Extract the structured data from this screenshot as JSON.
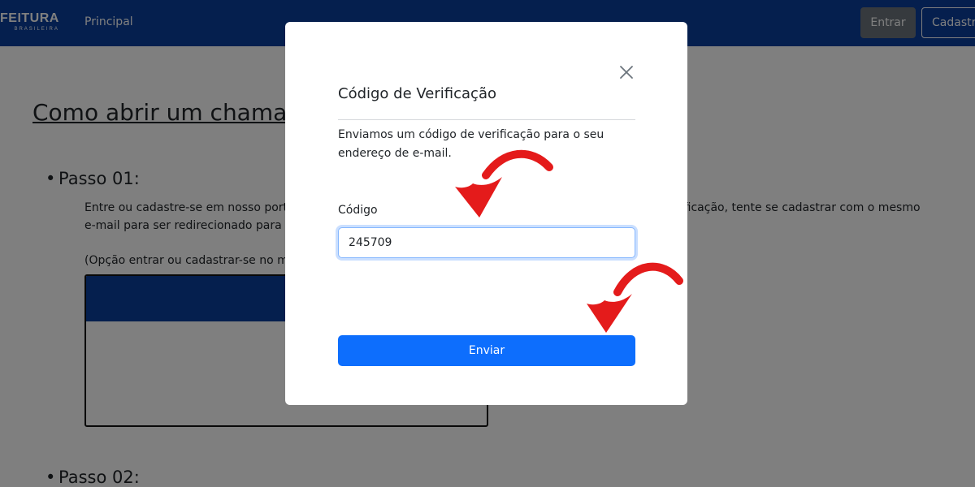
{
  "navbar": {
    "brand_main": "FEITURA",
    "brand_sub": "BRASILEIRA",
    "nav_link": "Principal",
    "login_label": "Entrar",
    "signup_label": "Cadastrar"
  },
  "page": {
    "title": "Como abrir um chamado",
    "step1_title": "Passo 01:",
    "step1_text_line1": "Entre ou cadastre-se em nosso portal. Caso você não receba o código de verificação, tente se cadastrar com o mesmo",
    "step1_text_line1_left": "Entre ou cadastre-se em nosso port",
    "step1_text_line1_right": "rificação, tente se cadastrar com o mesmo",
    "step1_text_line2": "e-mail para ser redirecionado para a",
    "step1_option": "(Opção entrar ou cadastrar-se no m",
    "step2_title": "Passo 02:"
  },
  "modal": {
    "title": "Código de Verificação",
    "close_icon": "close-icon",
    "text": "Enviamos um código de verificação para o seu endereço de e-mail.",
    "code_label": "Código",
    "code_value": "245709",
    "submit_label": "Enviar"
  },
  "colors": {
    "navbar": "#0b3f9c",
    "primary_button": "#0d6efd",
    "secondary_button": "#6c757d",
    "arrow": "#e41b1b"
  }
}
